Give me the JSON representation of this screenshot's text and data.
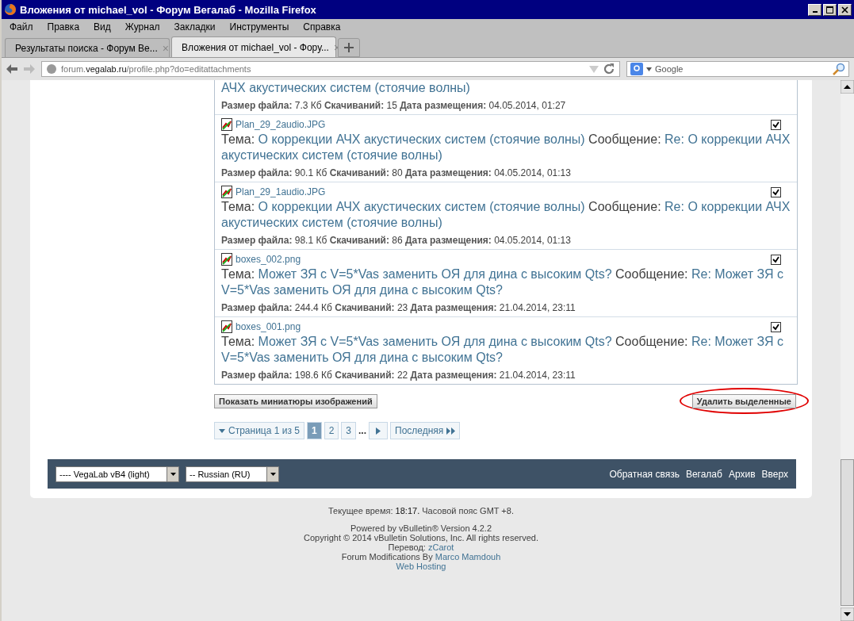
{
  "window": {
    "title": "Вложения от michael_vol - Форум Вегалаб - Mozilla Firefox"
  },
  "menu": [
    "Файл",
    "Правка",
    "Вид",
    "Журнал",
    "Закладки",
    "Инструменты",
    "Справка"
  ],
  "tabs": [
    {
      "label": "Результаты поиска - Форум Ве...",
      "close": "×",
      "selected": false
    },
    {
      "label": "Вложения от michael_vol - Фору...",
      "close": "×",
      "selected": true
    }
  ],
  "address": {
    "host_pre": "forum.",
    "host": "vegalab.ru",
    "path": "/profile.php?do=editattachments"
  },
  "search": {
    "placeholder": "Google"
  },
  "attachments": [
    {
      "kind": "partial",
      "topic_tail": "АЧХ акустических систем (стоячие волны)",
      "size_label": "Размер файла:",
      "size": "7.3 Кб",
      "downloads_label": "Скачиваний:",
      "downloads": "15",
      "date_label": "Дата размещения:",
      "date": "04.05.2014, 01:27"
    },
    {
      "kind": "full",
      "file": "Plan_29_2audio.JPG",
      "checked": true,
      "topic_label": "Тема:",
      "topic": "О коррекции АЧХ акустических систем (стоячие волны)",
      "post_label": "Сообщение:",
      "post": "Re: О коррекции АЧХ акустических систем (стоячие волны)",
      "size_label": "Размер файла:",
      "size": "90.1 Кб",
      "downloads_label": "Скачиваний:",
      "downloads": "80",
      "date_label": "Дата размещения:",
      "date": "04.05.2014, 01:13"
    },
    {
      "kind": "full",
      "file": "Plan_29_1audio.JPG",
      "checked": true,
      "topic_label": "Тема:",
      "topic": "О коррекции АЧХ акустических систем (стоячие волны)",
      "post_label": "Сообщение:",
      "post": "Re: О коррекции АЧХ акустических систем (стоячие волны)",
      "size_label": "Размер файла:",
      "size": "98.1 Кб",
      "downloads_label": "Скачиваний:",
      "downloads": "86",
      "date_label": "Дата размещения:",
      "date": "04.05.2014, 01:13"
    },
    {
      "kind": "full",
      "file": "boxes_002.png",
      "checked": true,
      "topic_label": "Тема:",
      "topic": "Может ЗЯ с V=5*Vas заменить ОЯ для дина с высоким Qts?",
      "post_label": "Сообщение:",
      "post": "Re: Может ЗЯ с V=5*Vas заменить ОЯ для дина с высоким Qts?",
      "size_label": "Размер файла:",
      "size": "244.4 Кб",
      "downloads_label": "Скачиваний:",
      "downloads": "23",
      "date_label": "Дата размещения:",
      "date": "21.04.2014, 23:11"
    },
    {
      "kind": "full",
      "file": "boxes_001.png",
      "checked": true,
      "topic_label": "Тема:",
      "topic": "Может ЗЯ с V=5*Vas заменить ОЯ для дина с высоким Qts?",
      "post_label": "Сообщение:",
      "post": "Re: Может ЗЯ с V=5*Vas заменить ОЯ для дина с высоким Qts?",
      "size_label": "Размер файла:",
      "size": "198.6 Кб",
      "downloads_label": "Скачиваний:",
      "downloads": "22",
      "date_label": "Дата размещения:",
      "date": "21.04.2014, 23:11"
    }
  ],
  "buttons": {
    "thumbnails": "Показать миниатюры изображений",
    "delete": "Удалить выделенные"
  },
  "pagination": {
    "label": "Страница 1 из 5",
    "pages": [
      {
        "label": "1",
        "selected": true
      },
      {
        "label": "2",
        "selected": false
      },
      {
        "label": "3",
        "selected": false
      }
    ],
    "ellipsis": "...",
    "last": "Последняя"
  },
  "footer": {
    "style": "---- VegaLab vB4 (light)",
    "language": "-- Russian (RU)",
    "links": [
      "Обратная связь",
      "Вегалаб",
      "Архив",
      "Вверх"
    ]
  },
  "time": {
    "label": "Текущее время:",
    "value": "18:17.",
    "zone": "Часовой пояс GMT +8."
  },
  "credits": {
    "powered": "Powered by vBulletin® Version 4.2.2",
    "copyright": "Copyright © 2014 vBulletin Solutions, Inc. All rights reserved.",
    "translation_label": "Перевод:",
    "translation": "zCarot",
    "mods_label": "Forum Modifications By",
    "mods": "Marco Mamdouh",
    "hosting": "Web Hosting"
  }
}
